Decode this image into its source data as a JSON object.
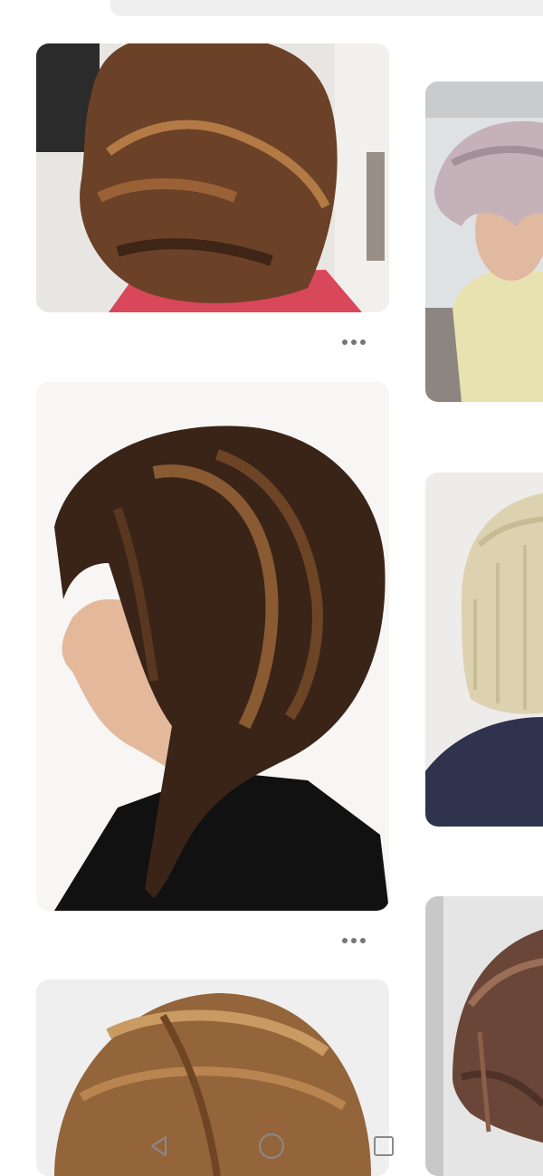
{
  "feed": {
    "pins": [
      {
        "id": "pin-1",
        "description_icon": "layered-medium-haircut-photo"
      },
      {
        "id": "pin-2",
        "description_icon": "pixie-cut-photo"
      },
      {
        "id": "pin-3",
        "description_icon": "angled-bob-photo"
      },
      {
        "id": "pin-4",
        "description_icon": "blonde-bob-photo"
      },
      {
        "id": "pin-5",
        "description_icon": "short-bob-photo"
      },
      {
        "id": "pin-6",
        "description_icon": "choppy-bob-photo"
      }
    ],
    "more_icon": "ellipsis-icon"
  },
  "system_nav": {
    "back_icon": "back-triangle-icon",
    "home_icon": "home-circle-icon",
    "recents_icon": "recents-square-icon"
  },
  "colors": {
    "background": "#ffffff",
    "search_bg": "#efefef",
    "dots": "#767676",
    "nav_icons": "#8a8a8a"
  }
}
